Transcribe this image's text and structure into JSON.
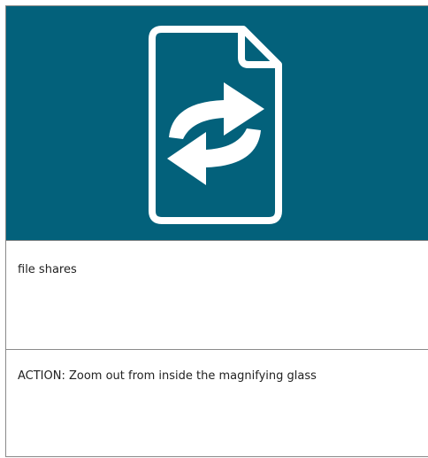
{
  "card": {
    "icon": "file-share-icon",
    "accent_color": "#03617b",
    "label": "file shares",
    "action_text": "ACTION: Zoom out from inside the magnifying glass"
  }
}
